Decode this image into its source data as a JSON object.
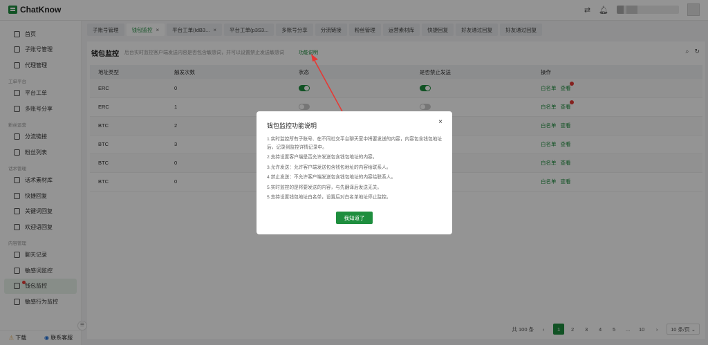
{
  "app": {
    "name": "ChatKnow"
  },
  "header": {
    "icons": [
      "translate-icon",
      "bell-icon"
    ]
  },
  "sidebar": {
    "groups": [
      {
        "title": "",
        "items": [
          {
            "label": "首页",
            "icon": "home-icon"
          },
          {
            "label": "子账号管理",
            "icon": "account-icon"
          },
          {
            "label": "代理管理",
            "icon": "proxy-icon"
          }
        ]
      },
      {
        "title": "工单平台",
        "items": [
          {
            "label": "平台工单",
            "icon": "ticket-icon"
          },
          {
            "label": "多账号分享",
            "icon": "share-icon"
          }
        ]
      },
      {
        "title": "粉丝运营",
        "items": [
          {
            "label": "分流链接",
            "icon": "link-icon"
          },
          {
            "label": "粉丝列表",
            "icon": "fans-icon"
          }
        ]
      },
      {
        "title": "话术管理",
        "items": [
          {
            "label": "话术素材库",
            "icon": "library-icon"
          },
          {
            "label": "快捷回复",
            "icon": "quick-reply-icon"
          },
          {
            "label": "关键词回复",
            "icon": "keyword-icon"
          },
          {
            "label": "欢迎语回复",
            "icon": "welcome-icon"
          }
        ]
      },
      {
        "title": "内容管理",
        "items": [
          {
            "label": "聊天记录",
            "icon": "chat-icon"
          },
          {
            "label": "敏感词监控",
            "icon": "sensitive-icon"
          },
          {
            "label": "钱包监控",
            "icon": "wallet-icon",
            "active": true
          },
          {
            "label": "敏感行为监控",
            "icon": "behavior-icon"
          }
        ]
      }
    ],
    "footer": {
      "download": "下载",
      "contact": "联系客服"
    }
  },
  "tabs": [
    {
      "label": "子账号管理"
    },
    {
      "label": "钱包监控",
      "active": true,
      "closable": true
    },
    {
      "label": "平台工单(IdB3...",
      "closable": true
    },
    {
      "label": "平台工单(p3S3..."
    },
    {
      "label": "多账号分享"
    },
    {
      "label": "分流链接"
    },
    {
      "label": "粉丝管理"
    },
    {
      "label": "运营素材库"
    },
    {
      "label": "快捷回复"
    },
    {
      "label": "好友通过回复"
    },
    {
      "label": "好友通过回复"
    }
  ],
  "page": {
    "title": "钱包监控",
    "description": "后台实时监控客户端发送内容是否包含敏感词，并可以设置禁止发送敏感词",
    "help_link": "功能说明"
  },
  "table": {
    "columns": [
      "地址类型",
      "触发次数",
      "状态",
      "是否禁止发送",
      "操作"
    ],
    "rows": [
      {
        "type": "ERC",
        "count": "0",
        "status": true,
        "forbid": true,
        "actions": [
          "白名单",
          "查看"
        ],
        "badge": true
      },
      {
        "type": "ERC",
        "count": "1",
        "status": false,
        "forbid": false,
        "actions": [
          "白名单",
          "查看"
        ],
        "badge": true
      },
      {
        "type": "BTC",
        "count": "2",
        "status": true,
        "forbid": true,
        "actions": [
          "白名单",
          "查看"
        ],
        "badge": false
      },
      {
        "type": "BTC",
        "count": "3",
        "status": false,
        "forbid": false,
        "actions": [
          "白名单",
          "查看"
        ],
        "badge": false
      },
      {
        "type": "BTC",
        "count": "0",
        "status": false,
        "forbid": false,
        "actions": [
          "白名单",
          "查看"
        ],
        "badge": false
      },
      {
        "type": "BTC",
        "count": "0",
        "status": false,
        "forbid": false,
        "actions": [
          "白名单",
          "查看"
        ],
        "badge": false
      }
    ]
  },
  "pagination": {
    "total": "共 100 条",
    "pages": [
      "1",
      "2",
      "3",
      "4",
      "5",
      "...",
      "10"
    ],
    "current": "1",
    "page_size": "10 条/页"
  },
  "modal": {
    "title": "钱包监控功能说明",
    "lines": [
      "1.实时监控所有子账号、在不同社交平台聊天室中将要发送的内容，内容包含钱包地址后，记录到监控详情记录中。",
      "2.支持设置客户端是否允许发送包含钱包地址的内容。",
      "3.允许发送：允许客户端发送包含钱包地址的内容给联系人。",
      "4.禁止发送：不允许客户端发送包含钱包地址的内容给联系人。",
      "5.实时监控的是将要发送的内容，与先翻译后发送无关。",
      "5.支持设置钱包地址白名单，设置后对白名单地址停止监控。"
    ],
    "confirm": "我知道了"
  },
  "colors": {
    "accent": "#1e8e3e",
    "danger": "#e53935"
  }
}
